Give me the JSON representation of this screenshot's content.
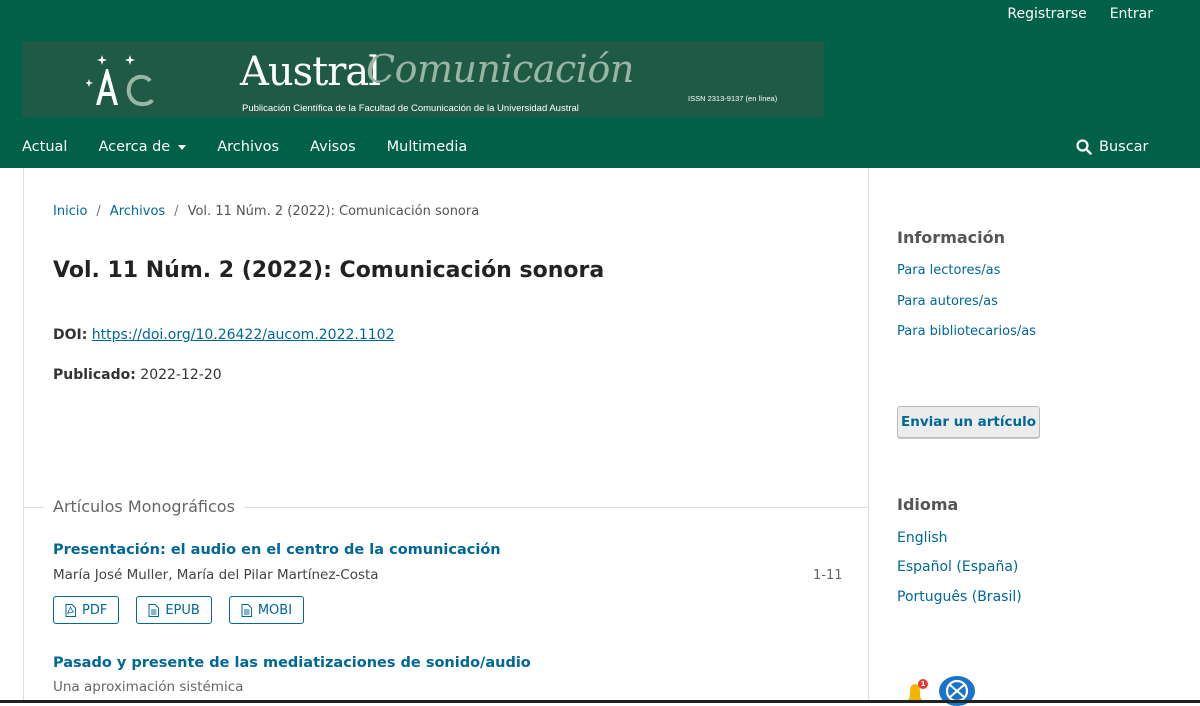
{
  "header": {
    "user_links": {
      "register": "Registrarse",
      "login": "Entrar"
    },
    "logo": {
      "initials": "AC",
      "austral": "Austral",
      "comunicacion": "Comunicación",
      "subtitle": "Publicación Científica de la Facultad de Comunicación de la Universidad Austral",
      "issn": "ISSN 2313-9137 (en línea)"
    }
  },
  "nav": {
    "items": [
      "Actual",
      "Acerca de",
      "Archivos",
      "Avisos",
      "Multimedia"
    ],
    "search": "Buscar"
  },
  "breadcrumb": {
    "home": "Inicio",
    "archives": "Archivos",
    "current": "Vol. 11 Núm. 2 (2022): Comunicación sonora"
  },
  "issue": {
    "title": "Vol. 11 Núm. 2 (2022): Comunicación sonora",
    "doi_label": "DOI:",
    "doi": "https://doi.org/10.26422/aucom.2022.1102",
    "published_label": "Publicado:",
    "published": "2022-12-20"
  },
  "section": {
    "title": "Artículos Monográficos"
  },
  "articles": [
    {
      "title": "Presentación: el audio en el centro de la comunicación",
      "authors": "María José Muller, María del Pilar Martínez-Costa",
      "pages": "1-11",
      "galleys": [
        "PDF",
        "EPUB",
        "MOBI"
      ]
    },
    {
      "title": "Pasado y presente de las mediatizaciones de sonido/audio",
      "subtitle": "Una aproximación sistémica"
    }
  ],
  "sidebar": {
    "info_title": "Información",
    "info_links": [
      "Para lectores/as",
      "Para autores/as",
      "Para bibliotecarios/as"
    ],
    "submit_button": "Enviar un artículo",
    "language_title": "Idioma",
    "languages": [
      "English",
      "Español (España)",
      "Português (Brasil)"
    ],
    "notification_count": "1"
  },
  "colors": {
    "header_bg": "#006147",
    "link": "#006798",
    "banner_bg": "#1f5a47"
  }
}
